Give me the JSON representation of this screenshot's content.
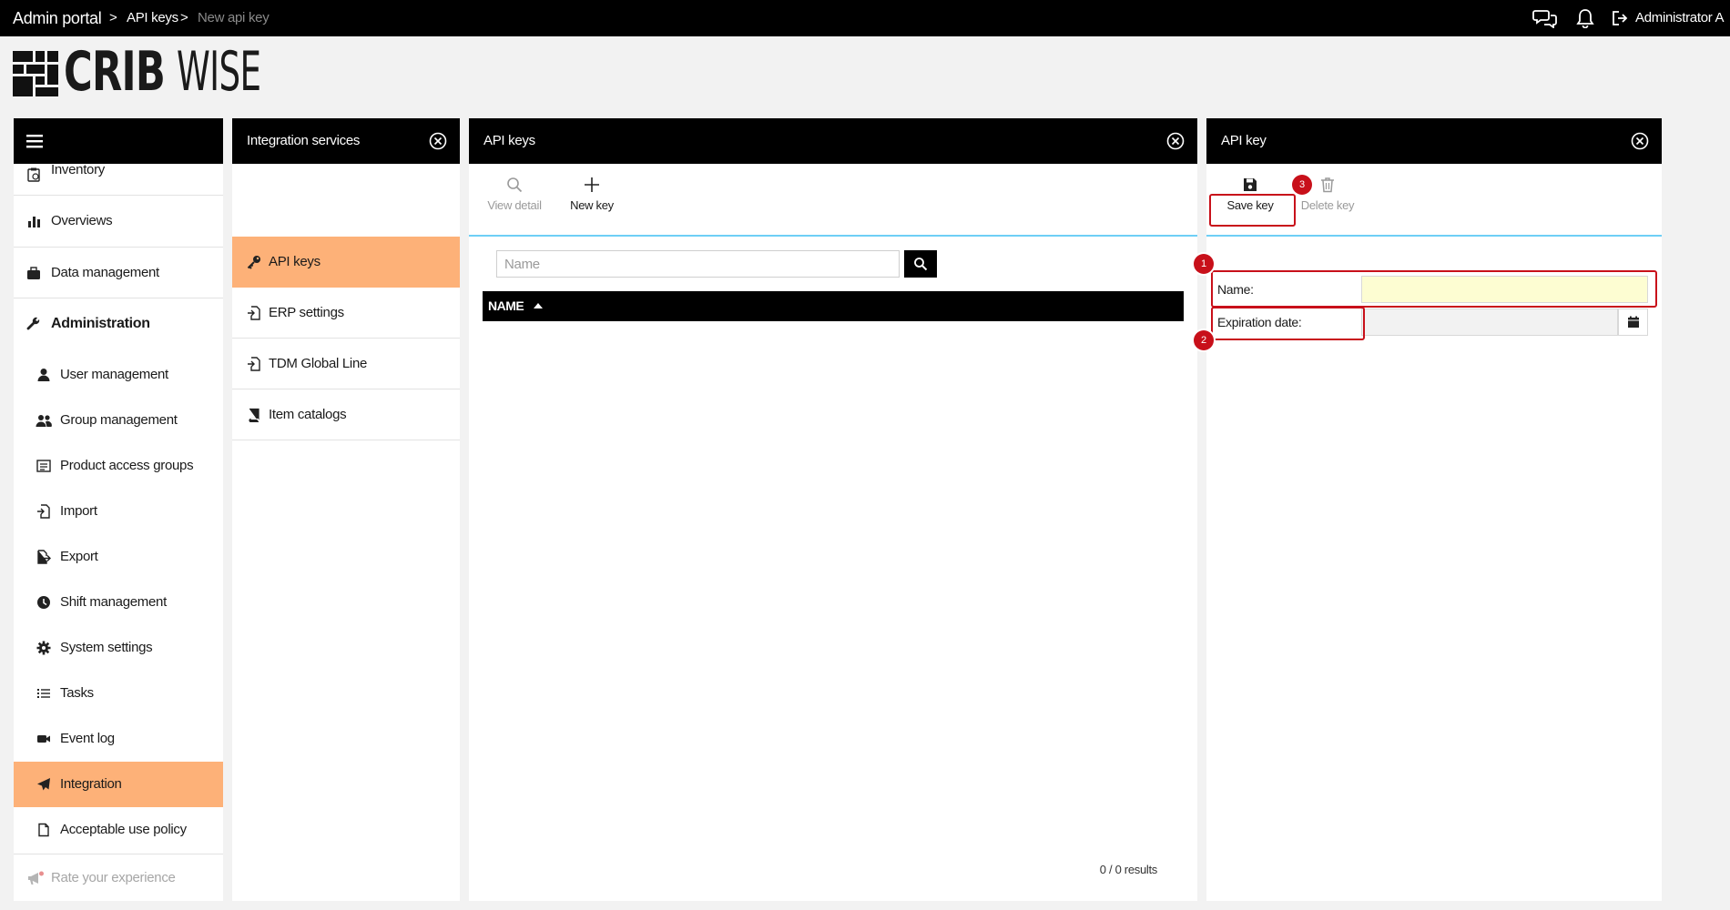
{
  "topbar": {
    "breadcrumbs": [
      "Admin portal",
      "API keys",
      "New api key"
    ],
    "separator": ">",
    "user_name": "Administrator A"
  },
  "logo": {
    "word_bold": "CRIB",
    "word_light": "WISE"
  },
  "nav": {
    "items": [
      {
        "label": "Inventory",
        "icon": "clipboard-icon"
      },
      {
        "label": "Overviews",
        "icon": "bar-chart-icon"
      },
      {
        "label": "Data management",
        "icon": "briefcase-icon"
      },
      {
        "label": "Administration",
        "icon": "wrench-icon"
      },
      {
        "label": "User management",
        "icon": "user-icon"
      },
      {
        "label": "Group management",
        "icon": "users-icon"
      },
      {
        "label": "Product access groups",
        "icon": "list-box-icon"
      },
      {
        "label": "Import",
        "icon": "file-import-icon"
      },
      {
        "label": "Export",
        "icon": "file-export-icon"
      },
      {
        "label": "Shift management",
        "icon": "clock-icon"
      },
      {
        "label": "System settings",
        "icon": "gear-icon"
      },
      {
        "label": "Tasks",
        "icon": "checklist-icon"
      },
      {
        "label": "Event log",
        "icon": "video-camera-icon"
      },
      {
        "label": "Integration",
        "icon": "paper-plane-icon"
      },
      {
        "label": "Acceptable use policy",
        "icon": "document-icon"
      },
      {
        "label": "Rate your experience",
        "icon": "megaphone-icon"
      }
    ],
    "active": "Integration"
  },
  "services_panel": {
    "title": "Integration services",
    "items": [
      {
        "label": "API keys",
        "icon": "key-icon"
      },
      {
        "label": "ERP settings",
        "icon": "file-import-icon"
      },
      {
        "label": "TDM Global Line",
        "icon": "file-import-icon"
      },
      {
        "label": "Item catalogs",
        "icon": "book-icon"
      }
    ],
    "active": "API keys"
  },
  "keys_panel": {
    "title": "API keys",
    "toolbar": {
      "view_detail": "View detail",
      "new_key": "New key"
    },
    "search": {
      "placeholder": "Name",
      "value": ""
    },
    "columns": [
      "NAME"
    ],
    "results": "0 / 0 results"
  },
  "detail_panel": {
    "title": "API key",
    "toolbar": {
      "save": "Save key",
      "delete": "Delete key"
    },
    "fields": {
      "name_label": "Name:",
      "name_value": "",
      "expiration_label": "Expiration date:",
      "expiration_value": ""
    }
  },
  "annotations": [
    "1",
    "2",
    "3"
  ],
  "colors": {
    "topbar": "#000000",
    "accent_active": "#fdb178",
    "toolbar_underline": "#6ecff6",
    "annotation": "#c8101a",
    "required_field": "#fdfdd2"
  }
}
